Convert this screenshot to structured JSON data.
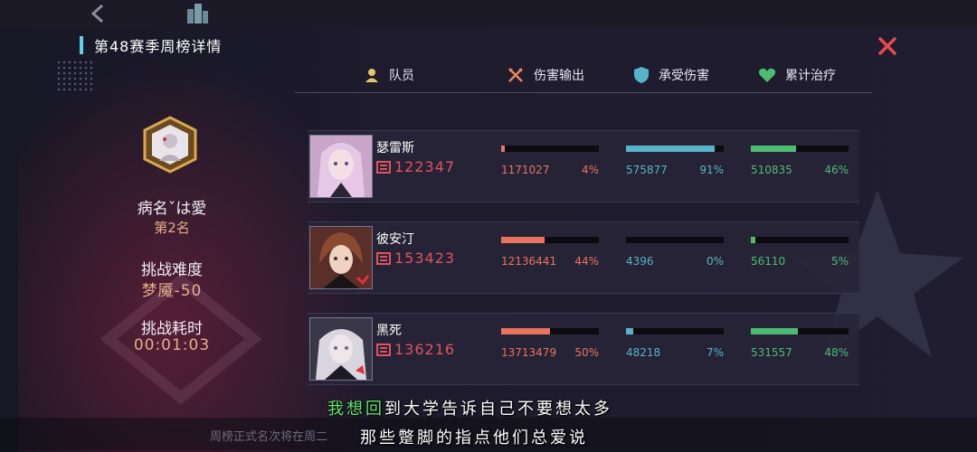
{
  "title": "第48赛季周榜详情",
  "player": {
    "name": "病名ˇは愛",
    "rank": "第2名",
    "difficulty_label": "挑战难度",
    "difficulty_value": "梦魇-50",
    "time_label": "挑战耗时",
    "time_value": "00:01:03"
  },
  "headers": {
    "member": "队员",
    "damage": "伤害输出",
    "taken": "承受伤害",
    "healing": "累计治疗"
  },
  "colors": {
    "damage": "#e8745f",
    "taken": "#57b4c8",
    "healing": "#4dbc72",
    "power": "#e0535e",
    "accent": "#5fd3e6"
  },
  "members": [
    {
      "name": "瑟雷斯",
      "power": "122347",
      "damage": "1171027",
      "damage_pct": "4%",
      "damage_frac": 0.04,
      "taken": "575877",
      "taken_pct": "91%",
      "taken_frac": 0.91,
      "healing": "510835",
      "healing_pct": "46%",
      "healing_frac": 0.46
    },
    {
      "name": "彼安汀",
      "power": "153423",
      "damage": "12136441",
      "damage_pct": "44%",
      "damage_frac": 0.44,
      "taken": "4396",
      "taken_pct": "0%",
      "taken_frac": 0.0,
      "healing": "56110",
      "healing_pct": "5%",
      "healing_frac": 0.05
    },
    {
      "name": "黑死",
      "power": "136216",
      "damage": "13713479",
      "damage_pct": "50%",
      "damage_frac": 0.5,
      "taken": "48218",
      "taken_pct": "7%",
      "taken_frac": 0.07,
      "healing": "531557",
      "healing_pct": "48%",
      "healing_frac": 0.48
    }
  ],
  "subtitle": {
    "line1_green": "我想回",
    "line1_rest": "到大学告诉自己不要想太多",
    "line2": "那些蹩脚的指点他们总爱说"
  },
  "notice": "周榜正式名次将在周二"
}
